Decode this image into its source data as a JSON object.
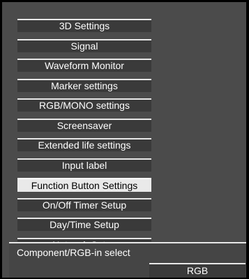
{
  "menu": {
    "items": [
      {
        "label": "3D Settings"
      },
      {
        "label": "Signal"
      },
      {
        "label": "Waveform Monitor"
      },
      {
        "label": "Marker settings"
      },
      {
        "label": "RGB/MONO settings"
      },
      {
        "label": "Screensaver"
      },
      {
        "label": "Extended life settings"
      },
      {
        "label": "Input label"
      },
      {
        "label": "Function Button Settings",
        "selected": true
      },
      {
        "label": "On/Off Timer Setup"
      },
      {
        "label": "Day/Time Setup"
      },
      {
        "label": "Network Setup"
      }
    ]
  },
  "sub_panel": {
    "title": "Component/RGB-in select",
    "value": "RGB"
  },
  "colors": {
    "panel_bg": "#4b4b4b",
    "item_bg": "#3a3a3a",
    "item_border": "#e8e8e8",
    "selected_bg": "#e9e9e9",
    "selected_text": "#000000",
    "text": "#ffffff"
  }
}
